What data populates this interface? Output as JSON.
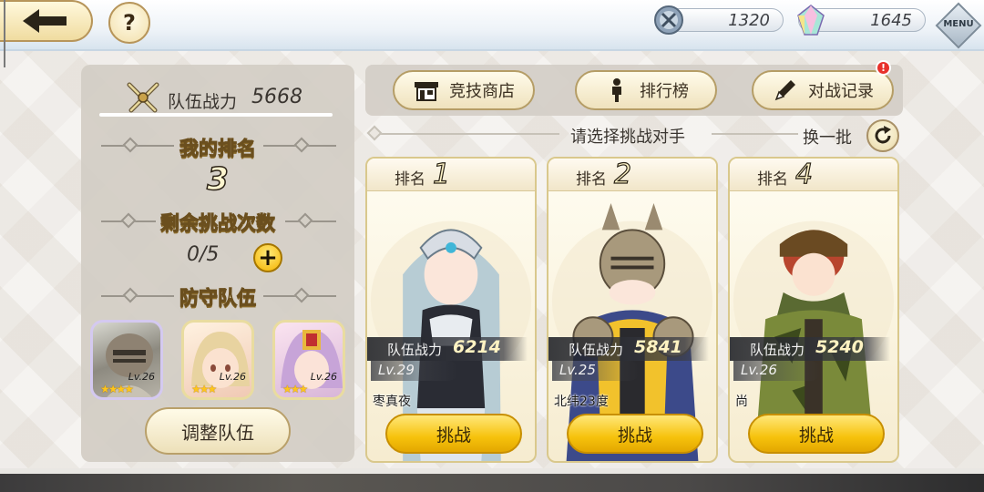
{
  "topbar": {
    "help_label": "?",
    "resource1": {
      "value": "1320",
      "icon": "swords-coin-icon"
    },
    "resource2": {
      "value": "1645",
      "icon": "crystal-icon"
    },
    "menu_label": "MENU"
  },
  "left_panel": {
    "team_power_label": "队伍战力",
    "team_power_value": "5668",
    "my_rank_label": "我的排名",
    "my_rank_value": "3",
    "remaining_label": "剩余挑战次数",
    "remaining_value": "0/5",
    "plus_label": "+",
    "defense_label": "防守队伍",
    "defense_team": [
      {
        "level": "Lv.26",
        "stars": "★★★★",
        "theme": "armored-knight"
      },
      {
        "level": "Lv.26",
        "stars": "★★★",
        "theme": "blonde-girl"
      },
      {
        "level": "Lv.26",
        "stars": "★★★",
        "theme": "purple-hair-girl"
      }
    ],
    "adjust_button": "调整队伍"
  },
  "nav": {
    "shop": "竞技商店",
    "ranking": "排行榜",
    "battle_log": "对战记录",
    "notification": "!"
  },
  "opponents_header": {
    "title": "请选择挑战对手",
    "refresh": "换一批"
  },
  "opponents": [
    {
      "rank_label": "排名",
      "rank": "1",
      "power_label": "队伍战力",
      "power": "6214",
      "level": "Lv.29",
      "name": "枣真夜",
      "button": "挑战"
    },
    {
      "rank_label": "排名",
      "rank": "2",
      "power_label": "队伍战力",
      "power": "5841",
      "level": "Lv.25",
      "name": "北纬23度",
      "button": "挑战"
    },
    {
      "rank_label": "排名",
      "rank": "4",
      "power_label": "队伍战力",
      "power": "5240",
      "level": "Lv.26",
      "name": "尚",
      "button": "挑战"
    }
  ],
  "colors": {
    "gold_button": "#f6c20c",
    "cream_button": "#fffbea",
    "panel_bg": "#d2cdc4",
    "alert_red": "#e8312c"
  }
}
